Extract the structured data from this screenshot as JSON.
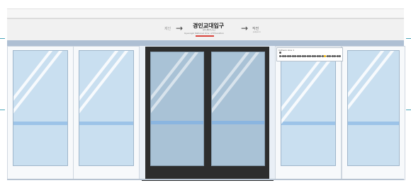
{
  "sign": {
    "prev_station": "제인",
    "arrow_left": "→",
    "station_name_ko": "경인교대입구",
    "station_name_han": "京仁教大入口",
    "station_name_en": "Gyeongin National Univ. of Education",
    "arrow_right": "→",
    "next_station": "작전",
    "next_station_sub": "Jakjeon"
  },
  "route_map": {
    "title": "Incheon Line 1",
    "stations_count_visible": 25,
    "current_index": 18
  },
  "colors": {
    "accent_red": "#d9433b",
    "glass": "#c9dff0",
    "door_frame": "#2d2d2d",
    "handle_band": "#9cc3e8"
  }
}
